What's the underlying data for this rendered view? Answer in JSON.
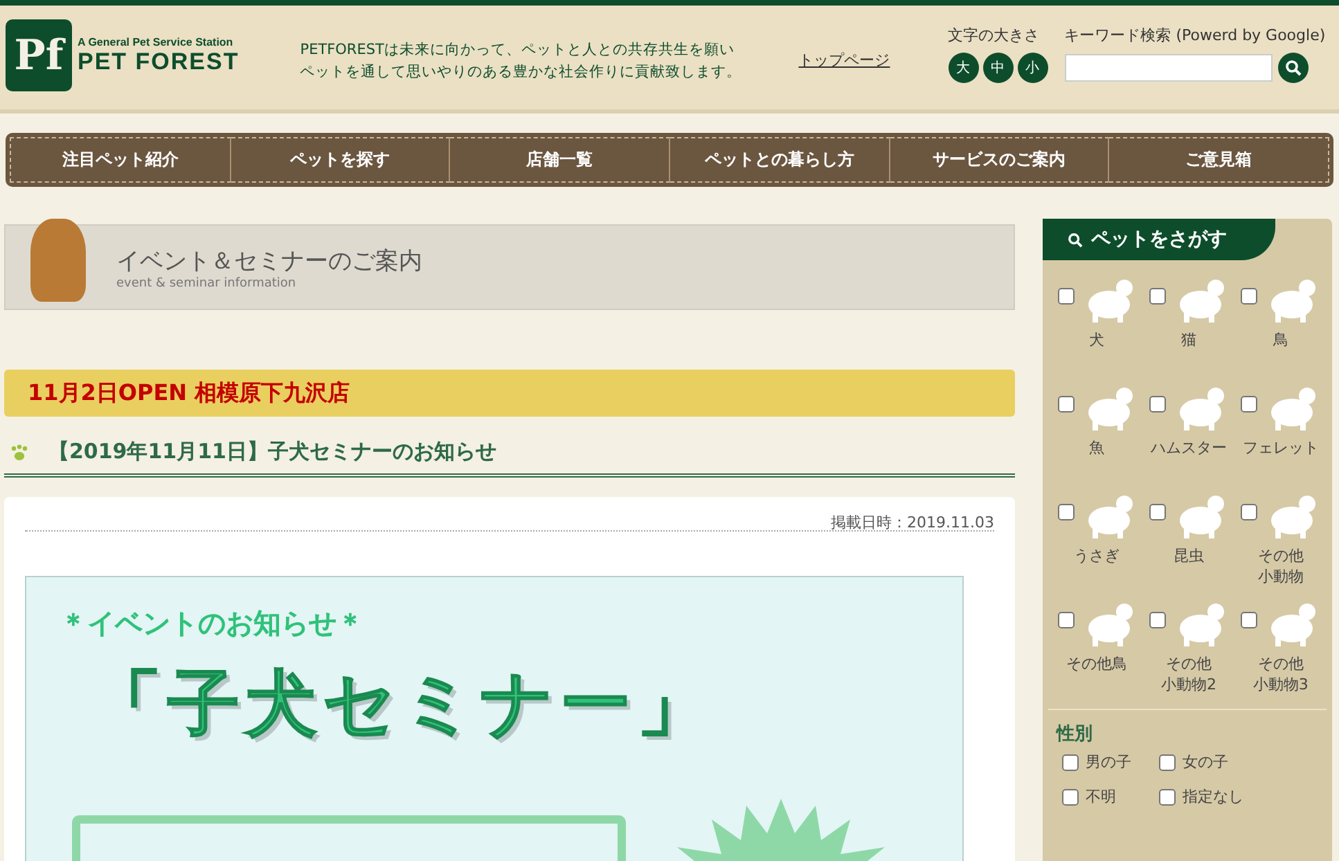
{
  "header": {
    "logo_mark": "Pf",
    "logo_tagline": "A General Pet Service Station",
    "logo_name": "PET FOREST",
    "mission": [
      "PETFORESTは未来に向かって、ペットと人との共存共生を願い",
      "ペットを通して思いやりのある豊かな社会作りに貢献致します。"
    ],
    "top_link": "トップページ",
    "font_size_label": "文字の大きさ",
    "font_sizes": [
      "大",
      "中",
      "小"
    ],
    "search_label": "キーワード検索 (Powerd by Google)"
  },
  "nav": [
    "注目ペット紹介",
    "ペットを探す",
    "店舗一覧",
    "ペットとの暮らし方",
    "サービスのご案内",
    "ご意見箱"
  ],
  "page_title": {
    "title": "イベント＆セミナーのご案内",
    "subtitle": "event & seminar information"
  },
  "notice": "11月2日OPEN 相模原下九沢店",
  "article": {
    "heading": "【2019年11月11日】子犬セミナーのお知らせ",
    "posted": "掲載日時：2019.11.03",
    "poster": {
      "kicker": "＊イベントのお知らせ＊",
      "title": "「子犬セミナー」"
    }
  },
  "sidebar": {
    "title": "ペットをさがす",
    "pets": [
      {
        "label": "犬",
        "checked": false
      },
      {
        "label": "猫",
        "checked": false
      },
      {
        "label": "鳥",
        "checked": false
      },
      {
        "label": "魚",
        "checked": false
      },
      {
        "label": "ハムスター",
        "checked": false
      },
      {
        "label": "フェレット",
        "checked": false
      },
      {
        "label": "うさぎ",
        "checked": false
      },
      {
        "label": "昆虫",
        "checked": false
      },
      {
        "label": "その他小動物",
        "checked": false
      },
      {
        "label": "その他鳥",
        "checked": false
      },
      {
        "label": "その他小動物2",
        "checked": false
      },
      {
        "label": "その他小動物3",
        "checked": false
      }
    ],
    "gender_title": "性別",
    "genders": [
      {
        "label": "男の子",
        "checked": false
      },
      {
        "label": "女の子",
        "checked": false
      },
      {
        "label": "不明",
        "checked": false
      },
      {
        "label": "指定なし",
        "checked": false
      }
    ]
  }
}
